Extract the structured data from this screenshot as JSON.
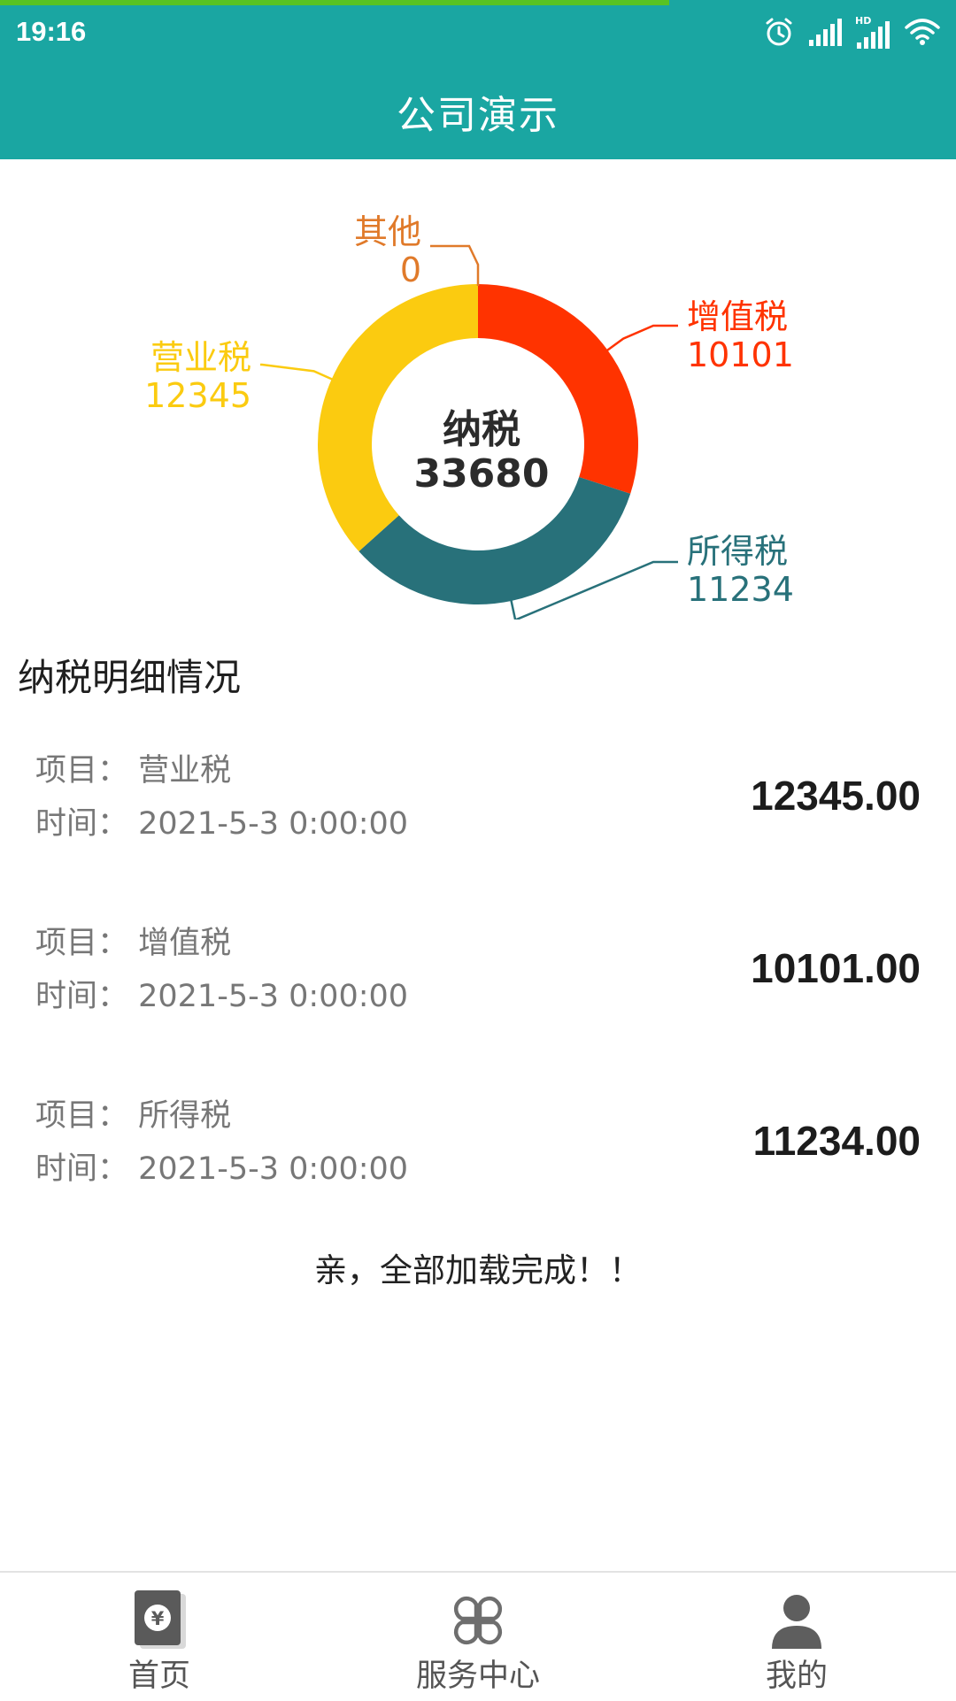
{
  "status_bar": {
    "time": "19:16",
    "load_progress": 0.7,
    "icons": [
      "alarm-icon",
      "signal-icon",
      "hd-signal-icon",
      "wifi-icon"
    ],
    "hd_label": "HD"
  },
  "header": {
    "title": "公司演示"
  },
  "chart_data": {
    "type": "pie",
    "center_label": "纳税",
    "center_value": "33680",
    "slices": [
      {
        "name": "增值税",
        "value": 10101,
        "color": "#ff3300"
      },
      {
        "name": "所得税",
        "value": 11234,
        "color": "#28717a"
      },
      {
        "name": "营业税",
        "value": 12345,
        "color": "#fbcb10"
      },
      {
        "name": "其他",
        "value": 0,
        "color": "#e07a2a"
      }
    ]
  },
  "section": {
    "title": "纳税明细情况"
  },
  "details": [
    {
      "project": "项目：  营业税",
      "time": "时间：  2021-5-3 0:00:00",
      "amount": "12345.00"
    },
    {
      "project": "项目：  增值税",
      "time": "时间：  2021-5-3 0:00:00",
      "amount": "10101.00"
    },
    {
      "project": "项目：  所得税",
      "time": "时间：  2021-5-3 0:00:00",
      "amount": "11234.00"
    }
  ],
  "footer_text": "亲，全部加载完成！！",
  "bottom_nav": [
    {
      "label": "首页",
      "icon": "yuan-book-icon"
    },
    {
      "label": "服务中心",
      "icon": "clover-icon"
    },
    {
      "label": "我的",
      "icon": "user-icon"
    }
  ]
}
